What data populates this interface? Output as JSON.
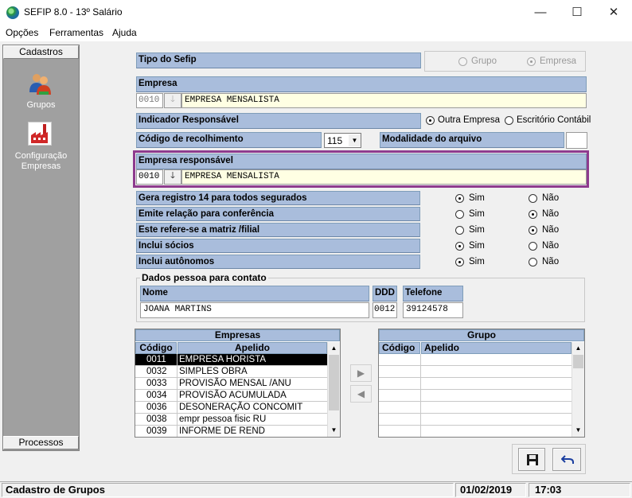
{
  "window": {
    "title": "SEFIP 8.0 - 13º Salário",
    "min": "—",
    "max": "☐",
    "close": "✕"
  },
  "menu": [
    {
      "label": "Opções"
    },
    {
      "label": "Ferramentas"
    },
    {
      "label": "Ajuda"
    }
  ],
  "sidebar": {
    "top_header": "Cadastros",
    "bottom_header": "Processos",
    "items": [
      {
        "label": "Grupos",
        "icon": "users-icon"
      },
      {
        "label_line1": "Configuração",
        "label_line2": "Empresas",
        "icon": "factory-icon"
      }
    ]
  },
  "form": {
    "tipo_sefip": {
      "label": "Tipo do Sefip",
      "options": [
        "Grupo",
        "Empresa"
      ],
      "selected": "Empresa"
    },
    "empresa": {
      "label": "Empresa",
      "code": "0010",
      "name": "EMPRESA MENSALISTA"
    },
    "indicador": {
      "label": "Indicador Responsável",
      "options": [
        "Outra Empresa",
        "Escritório Contábil"
      ],
      "selected": "Outra Empresa"
    },
    "codigo_recolhimento": {
      "label": "Código de recolhimento",
      "value": "115",
      "arrow": "▼"
    },
    "modalidade": {
      "label": "Modalidade do arquivo",
      "value": ""
    },
    "empresa_responsavel": {
      "label": "Empresa responsável",
      "code": "0010",
      "name": "EMPRESA MENSALISTA",
      "highlight_color": "#8e3b8e"
    },
    "yes_label": "Sim",
    "no_label": "Não",
    "questions": [
      {
        "label": "Gera registro 14 para todos segurados",
        "value": "Sim"
      },
      {
        "label": "Emite relação para conferência",
        "value": "Não"
      },
      {
        "label": "Este refere-se a matriz /filial",
        "value": "Não"
      },
      {
        "label": "Inclui sócios",
        "value": "Sim"
      },
      {
        "label": "Inclui autônomos",
        "value": "Sim"
      }
    ],
    "contato": {
      "title": "Dados pessoa para contato",
      "nome_label": "Nome",
      "nome": "JOANA MARTINS",
      "ddd_label": "DDD",
      "ddd": "0012",
      "telefone_label": "Telefone",
      "telefone": "39124578"
    }
  },
  "empresas_table": {
    "title": "Empresas",
    "col_codigo": "Código",
    "col_apelido": "Apelido",
    "rows": [
      {
        "codigo": "0011",
        "apelido": "EMPRESA HORISTA",
        "selected": true
      },
      {
        "codigo": "0032",
        "apelido": "SIMPLES OBRA"
      },
      {
        "codigo": "0033",
        "apelido": "PROVISÃO MENSAL /ANU"
      },
      {
        "codigo": "0034",
        "apelido": "PROVISÃO ACUMULADA"
      },
      {
        "codigo": "0036",
        "apelido": "DESONERAÇÃO CONCOMIT"
      },
      {
        "codigo": "0038",
        "apelido": "empr pessoa fisic RU"
      },
      {
        "codigo": "0039",
        "apelido": "INFORME DE REND"
      }
    ]
  },
  "grupo_table": {
    "title": "Grupo",
    "col_codigo": "Código",
    "col_apelido": "Apelido"
  },
  "transfer": {
    "add": "▶",
    "remove": "◀"
  },
  "status": {
    "text": "Cadastro de Grupos",
    "date": "01/02/2019",
    "time": "17:03"
  }
}
